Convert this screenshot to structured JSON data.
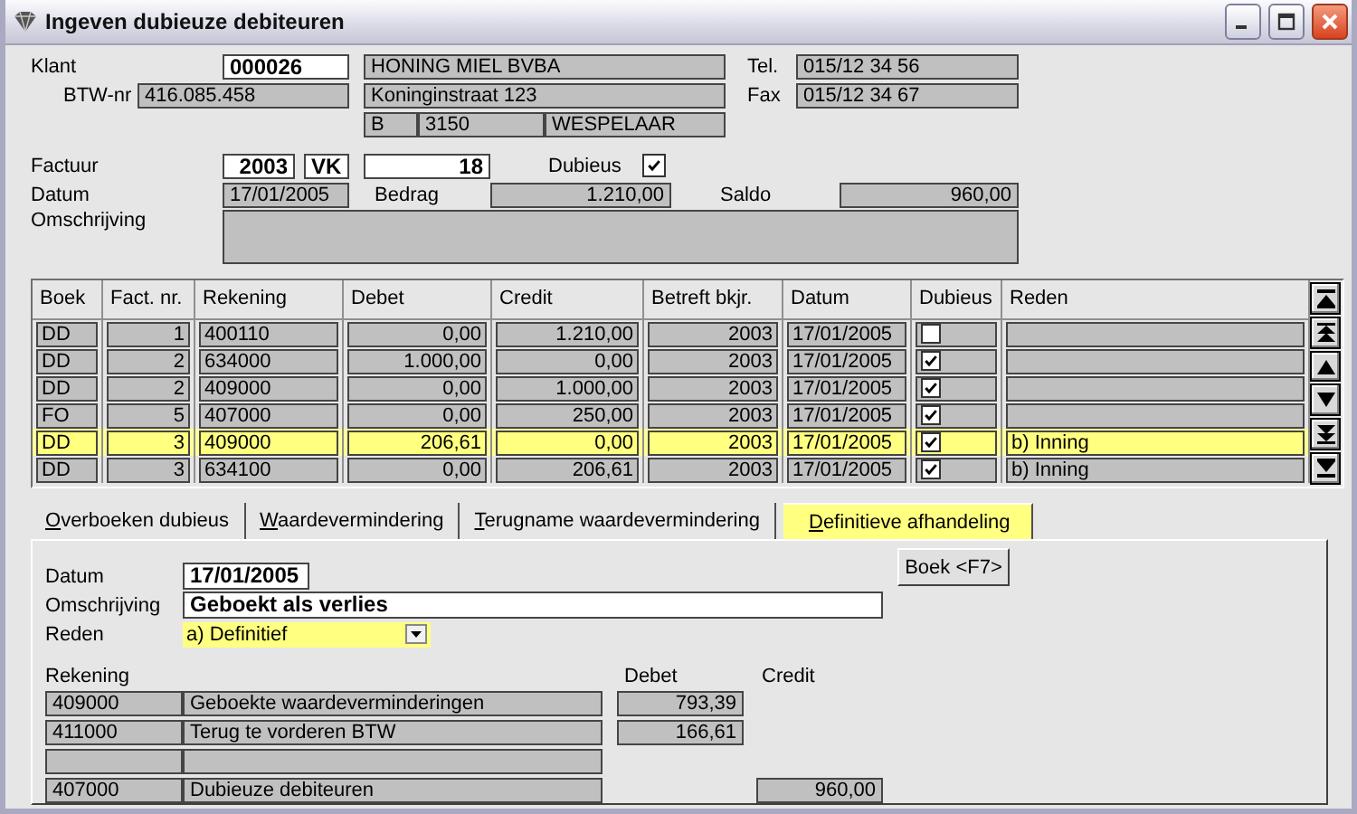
{
  "window": {
    "title": "Ingeven dubieuze debiteuren"
  },
  "header": {
    "klant": {
      "label": "Klant",
      "value": "000026"
    },
    "name": "HONING MIEL BVBA",
    "tel": {
      "label": "Tel.",
      "value": "015/12 34 56"
    },
    "btw": {
      "label": "BTW-nr",
      "value": "416.085.458"
    },
    "street": "Koninginstraat 123",
    "fax": {
      "label": "Fax",
      "value": "015/12 34 67"
    },
    "country": "B",
    "postcode": "3150",
    "city": "WESPELAAR",
    "factuur": {
      "label": "Factuur",
      "year": "2003",
      "journal": "VK",
      "number": "18"
    },
    "dubieus": {
      "label": "Dubieus",
      "checked": true
    },
    "datum": {
      "label": "Datum",
      "value": "17/01/2005"
    },
    "bedrag": {
      "label": "Bedrag",
      "value": "1.210,00"
    },
    "saldo": {
      "label": "Saldo",
      "value": "960,00"
    },
    "omschrijving": {
      "label": "Omschrijving"
    }
  },
  "grid": {
    "columns": [
      "Boek",
      "Fact. nr.",
      "Rekening",
      "Debet",
      "Credit",
      "Betreft bkjr.",
      "Datum",
      "Dubieus",
      "Reden"
    ],
    "rows": [
      {
        "boek": "DD",
        "fact_nr": "1",
        "rekening": "400110",
        "debet": "0,00",
        "credit": "1.210,00",
        "bkjr": "2003",
        "datum": "17/01/2005",
        "dubieus": false,
        "selected": false
      },
      {
        "boek": "DD",
        "fact_nr": "2",
        "rekening": "634000",
        "debet": "1.000,00",
        "credit": "0,00",
        "bkjr": "2003",
        "datum": "17/01/2005",
        "dubieus": true,
        "selected": false
      },
      {
        "boek": "DD",
        "fact_nr": "2",
        "rekening": "409000",
        "debet": "0,00",
        "credit": "1.000,00",
        "bkjr": "2003",
        "datum": "17/01/2005",
        "dubieus": true,
        "selected": false
      },
      {
        "boek": "FO",
        "fact_nr": "5",
        "rekening": "407000",
        "debet": "0,00",
        "credit": "250,00",
        "bkjr": "2003",
        "datum": "17/01/2005",
        "dubieus": true,
        "selected": false
      },
      {
        "boek": "DD",
        "fact_nr": "3",
        "rekening": "409000",
        "debet": "206,61",
        "credit": "0,00",
        "bkjr": "2003",
        "datum": "17/01/2005",
        "dubieus": true,
        "reden": "b) Inning",
        "selected": true
      },
      {
        "boek": "DD",
        "fact_nr": "3",
        "rekening": "634100",
        "debet": "0,00",
        "credit": "206,61",
        "bkjr": "2003",
        "datum": "17/01/2005",
        "dubieus": true,
        "reden": "b) Inning",
        "selected": false
      }
    ]
  },
  "tabs": [
    {
      "label": "Overboeken dubieus",
      "selected": false
    },
    {
      "label": "Waardevermindering",
      "selected": false
    },
    {
      "label": "Terugname waardevermindering",
      "selected": false
    },
    {
      "label": "Definitieve afhandeling",
      "selected": true
    }
  ],
  "panel": {
    "datum": {
      "label": "Datum",
      "value": "17/01/2005"
    },
    "omschrijving": {
      "label": "Omschrijving",
      "value": "Geboekt als verlies"
    },
    "reden": {
      "label": "Reden",
      "value": "a) Definitief"
    },
    "book_button": "Boek <F7>",
    "columns": {
      "rekening": "Rekening",
      "debet": "Debet",
      "credit": "Credit"
    },
    "lines": [
      {
        "kind": "entry",
        "account": "409000",
        "description": "Geboekte waardeverminderingen",
        "debet": "793,39"
      },
      {
        "kind": "entry",
        "account": "411000",
        "description": "Terug te vorderen BTW",
        "debet": "166,61"
      },
      {
        "kind": "blank"
      },
      {
        "kind": "entry",
        "account": "407000",
        "description": "Dubieuze debiteuren",
        "credit": "960,00"
      }
    ]
  }
}
